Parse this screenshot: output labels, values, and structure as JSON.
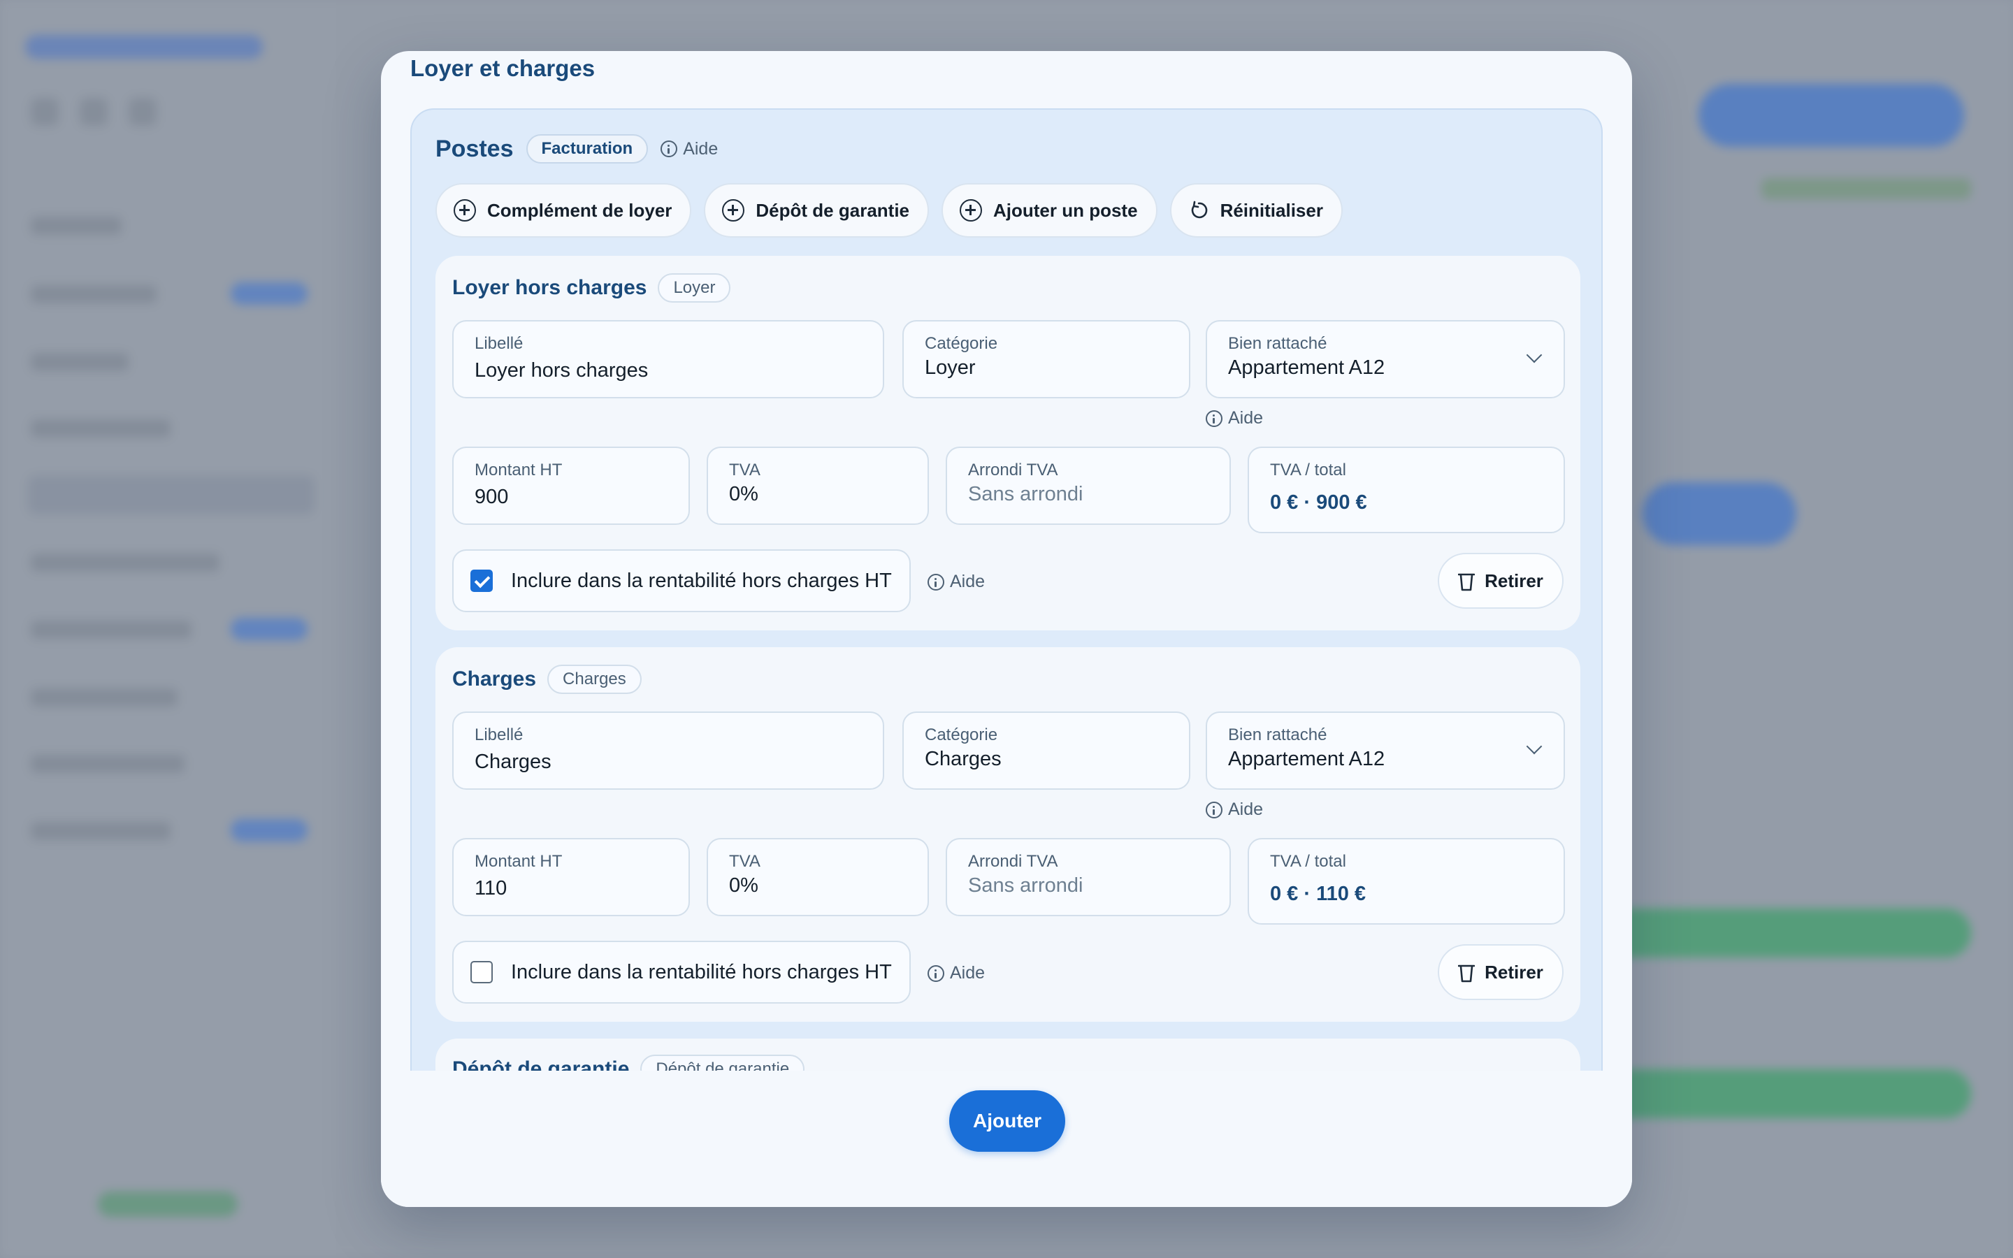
{
  "modal": {
    "title": "Loyer et charges",
    "add_label": "Ajouter"
  },
  "postes": {
    "title": "Postes",
    "badge": "Facturation",
    "help": "Aide",
    "actions": [
      {
        "label": "Complément de loyer",
        "icon": "plus-circle-icon"
      },
      {
        "label": "Dépôt de garantie",
        "icon": "plus-circle-icon"
      },
      {
        "label": "Ajouter un poste",
        "icon": "plus-circle-icon"
      },
      {
        "label": "Réinitialiser",
        "icon": "reset-icon"
      }
    ]
  },
  "cards": [
    {
      "title": "Loyer hors charges",
      "badge": "Loyer",
      "libelle_label": "Libellé",
      "libelle_value": "Loyer hors charges",
      "categorie_label": "Catégorie",
      "categorie_value": "Loyer",
      "bien_label": "Bien rattaché",
      "bien_value": "Appartement A12",
      "bien_help": "Aide",
      "montant_label": "Montant HT",
      "montant_value": "900",
      "tva_label": "TVA",
      "tva_value": "0%",
      "arrondi_label": "Arrondi TVA",
      "arrondi_value": "Sans arrondi",
      "total_label": "TVA / total",
      "total_value": "0 € · 900 €",
      "include_label": "Inclure dans la rentabilité hors charges HT",
      "include_checked": true,
      "include_help": "Aide",
      "remove_label": "Retirer"
    },
    {
      "title": "Charges",
      "badge": "Charges",
      "libelle_label": "Libellé",
      "libelle_value": "Charges",
      "categorie_label": "Catégorie",
      "categorie_value": "Charges",
      "bien_label": "Bien rattaché",
      "bien_value": "Appartement A12",
      "bien_help": "Aide",
      "montant_label": "Montant HT",
      "montant_value": "110",
      "tva_label": "TVA",
      "tva_value": "0%",
      "arrondi_label": "Arrondi TVA",
      "arrondi_value": "Sans arrondi",
      "total_label": "TVA / total",
      "total_value": "0 € · 110 €",
      "include_label": "Inclure dans la rentabilité hors charges HT",
      "include_checked": false,
      "include_help": "Aide",
      "remove_label": "Retirer"
    },
    {
      "title": "Dépôt de garantie",
      "badge": "Dépôt de garantie"
    }
  ],
  "colors": {
    "accent": "#1a6fd8",
    "title": "#1a4a7a",
    "panel": "#deebfa"
  }
}
